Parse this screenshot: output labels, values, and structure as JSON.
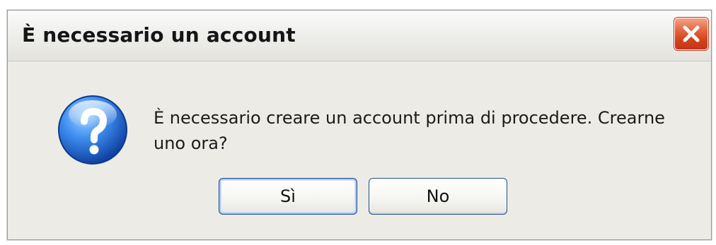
{
  "dialog": {
    "title": "È necessario un account",
    "message": "È necessario creare un account prima di procedere. Crearne uno ora?",
    "icon": "question-icon",
    "close_icon": "close-icon",
    "buttons": {
      "yes_label": "Sì",
      "no_label": "No"
    }
  },
  "colors": {
    "close_button": "#d2421a",
    "icon_blue": "#1f6ed8",
    "default_button_border": "#1f4f8f",
    "dialog_background": "#ecebe6"
  }
}
